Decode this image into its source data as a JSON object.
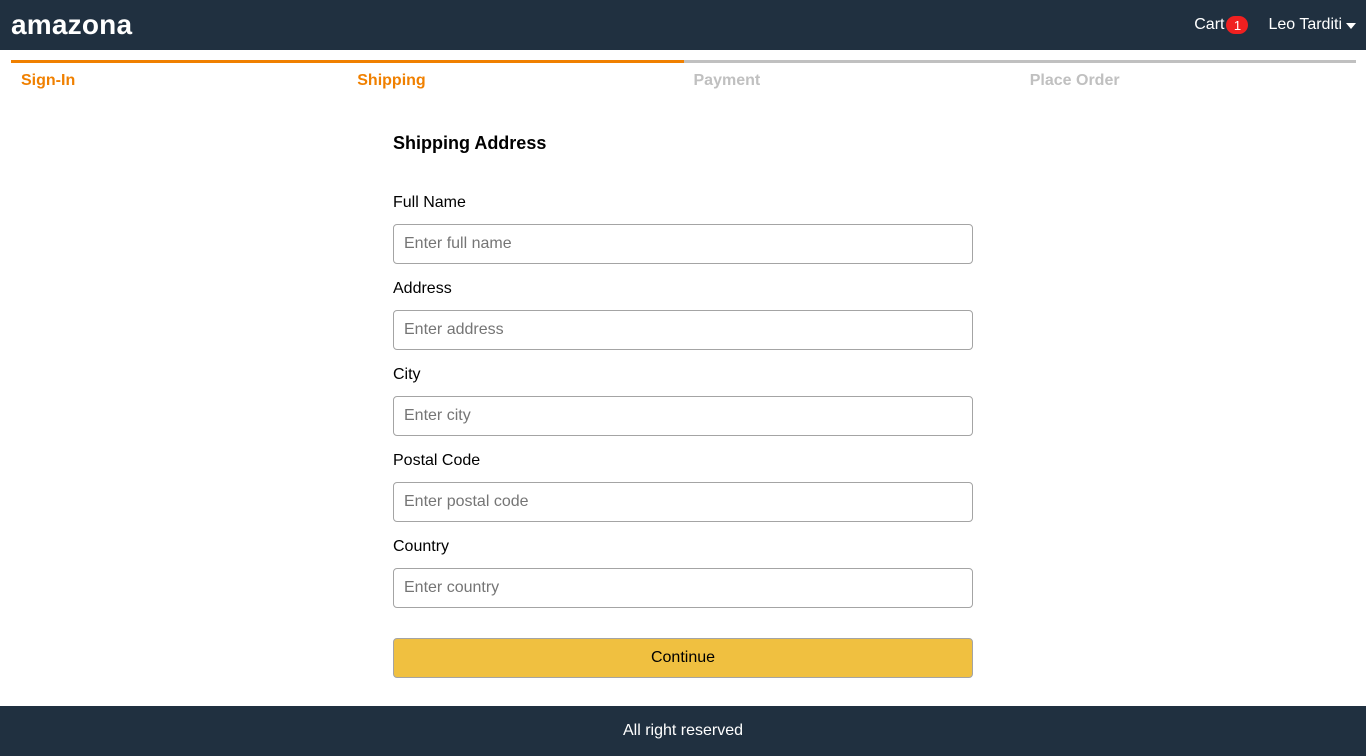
{
  "header": {
    "brand": "amazona",
    "cart_label": "Cart",
    "cart_count": "1",
    "user_name": "Leo Tarditi"
  },
  "steps": [
    {
      "label": "Sign-In",
      "active": true
    },
    {
      "label": "Shipping",
      "active": true
    },
    {
      "label": "Payment",
      "active": false
    },
    {
      "label": "Place Order",
      "active": false
    }
  ],
  "form": {
    "title": "Shipping Address",
    "fields": [
      {
        "label": "Full Name",
        "placeholder": "Enter full name",
        "value": ""
      },
      {
        "label": "Address",
        "placeholder": "Enter address",
        "value": ""
      },
      {
        "label": "City",
        "placeholder": "Enter city",
        "value": ""
      },
      {
        "label": "Postal Code",
        "placeholder": "Enter postal code",
        "value": ""
      },
      {
        "label": "Country",
        "placeholder": "Enter country",
        "value": ""
      }
    ],
    "submit_label": "Continue"
  },
  "footer": {
    "text": "All right reserved"
  },
  "colors": {
    "header_bg": "#203040",
    "accent": "#f08000",
    "button_bg": "#f0c040",
    "badge_bg": "#f02020",
    "inactive_step": "#c0c0c0"
  }
}
